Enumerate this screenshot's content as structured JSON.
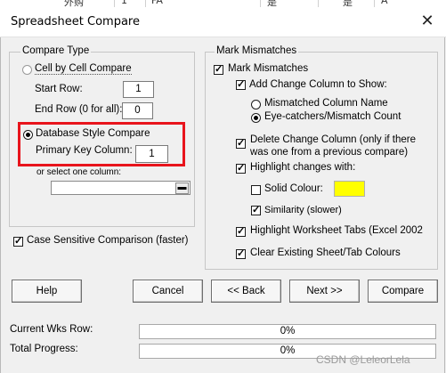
{
  "sheet_strip": [
    "外购",
    "1",
    "FA",
    "是",
    "是",
    "A"
  ],
  "dialog": {
    "title": "Spreadsheet Compare",
    "close_glyph": "✕"
  },
  "compare_type": {
    "legend": "Compare Type",
    "cell_by_cell": {
      "label": "Cell by Cell Compare",
      "selected": false
    },
    "start_row": {
      "label": "Start Row:",
      "value": "1"
    },
    "end_row": {
      "label": "End Row (0 for all):",
      "value": "0"
    },
    "database_style": {
      "label": "Database Style Compare",
      "selected": true
    },
    "primary_key": {
      "label": "Primary Key Column:",
      "value": "1"
    },
    "select_column": {
      "label": "or select one column:",
      "value": "",
      "dropdown_glyph": "▬"
    }
  },
  "case_sensitive": {
    "label": "Case Sensitive Comparison (faster)",
    "checked": true
  },
  "mark_mismatches": {
    "legend": "Mark Mismatches",
    "main": {
      "label": "Mark Mismatches",
      "checked": true
    },
    "add_change_column": {
      "label": "Add Change Column to Show:",
      "checked": true
    },
    "mismatched_column_name": {
      "label": "Mismatched Column Name",
      "selected": false
    },
    "eye_catchers": {
      "label": "Eye-catchers/Mismatch Count",
      "selected": true
    },
    "delete_change_column": {
      "line1": "Delete Change Column (only if there",
      "line2": "was one from a previous compare)",
      "checked": true
    },
    "highlight_changes": {
      "label": "Highlight changes with:",
      "checked": true
    },
    "solid_colour": {
      "label": "Solid Colour:",
      "checked": false,
      "color": "#ffff00"
    },
    "similarity": {
      "label": "Similarity (slower)",
      "checked": true
    },
    "highlight_tabs": {
      "label": "Highlight Worksheet Tabs (Excel 2002",
      "checked": true
    },
    "clear_colours": {
      "label": "Clear Existing Sheet/Tab Colours",
      "checked": true
    }
  },
  "buttons": {
    "help": "Help",
    "cancel": "Cancel",
    "back": "<< Back",
    "next": "Next >>",
    "compare": "Compare"
  },
  "progress": {
    "current_label": "Current Wks Row:",
    "current_value": "0%",
    "total_label": "Total Progress:",
    "total_value": "0%"
  },
  "check_glyph": "✓",
  "highlight_color": "#e8141c",
  "watermark": "CSDN @LeleorLela"
}
